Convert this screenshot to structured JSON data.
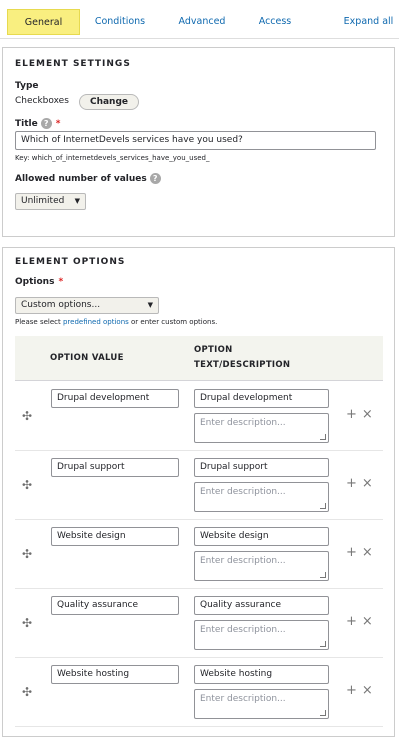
{
  "tabs": [
    {
      "label": "General"
    },
    {
      "label": "Conditions"
    },
    {
      "label": "Advanced"
    },
    {
      "label": "Access"
    },
    {
      "label": "Expand all"
    }
  ],
  "settings": {
    "heading": "ELEMENT SETTINGS",
    "type_label": "Type",
    "type_value": "Checkboxes",
    "change_button": "Change",
    "title_label": "Title",
    "title_value": "Which of InternetDevels services have you used?",
    "key_text": "Key: which_of_internetdevels_services_have_you_used_",
    "allowed_label": "Allowed number of values",
    "allowed_value": "Unlimited"
  },
  "options_section": {
    "heading": "ELEMENT OPTIONS",
    "options_label": "Options",
    "select_value": "Custom options...",
    "hint_prefix": "Please select ",
    "hint_link": "predefined options",
    "hint_suffix": " or enter custom options.",
    "col_value": "OPTION VALUE",
    "col_text_line1": "OPTION",
    "col_text_line2": "TEXT/DESCRIPTION",
    "description_placeholder": "Enter description...",
    "rows": [
      {
        "value": "Drupal development",
        "text": "Drupal development"
      },
      {
        "value": "Drupal support",
        "text": "Drupal support"
      },
      {
        "value": "Website design",
        "text": "Website design"
      },
      {
        "value": "Quality assurance",
        "text": "Quality assurance"
      },
      {
        "value": "Website hosting",
        "text": "Website hosting"
      }
    ]
  },
  "icons": {
    "help": "?",
    "required": "*",
    "caret": "▼",
    "drag": "✣",
    "add": "+",
    "remove": "×"
  },
  "colors": {
    "active_tab": "#f9ef80",
    "link": "#0f69af",
    "required": "#dc2323"
  }
}
